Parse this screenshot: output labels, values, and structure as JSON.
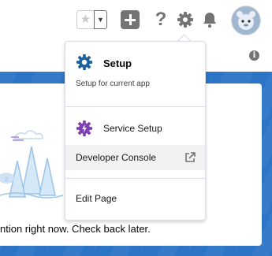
{
  "header": {
    "favorites": {
      "star_icon": "star-icon",
      "dropdown_icon": "chevron-down-icon"
    },
    "icons": [
      "add-icon",
      "help-icon",
      "gear-icon",
      "bell-icon"
    ],
    "help_glyph": "?"
  },
  "info_glyph": "i",
  "setup_menu": {
    "title": "Setup",
    "subtitle": "Setup for current app",
    "items": [
      {
        "label": "Service Setup",
        "icon": "service-setup-gear-icon"
      },
      {
        "label": "Developer Console",
        "icon": "external-link-icon",
        "highlighted": true
      },
      {
        "label": "Edit Page"
      }
    ]
  },
  "page": {
    "empty_message": "ntion right now. Check back later."
  },
  "colors": {
    "setup_gear": "#1b5f9e",
    "service_gear": "#7e3fb1",
    "brand_band": "#2b74c6",
    "icon_gray": "#747474"
  }
}
